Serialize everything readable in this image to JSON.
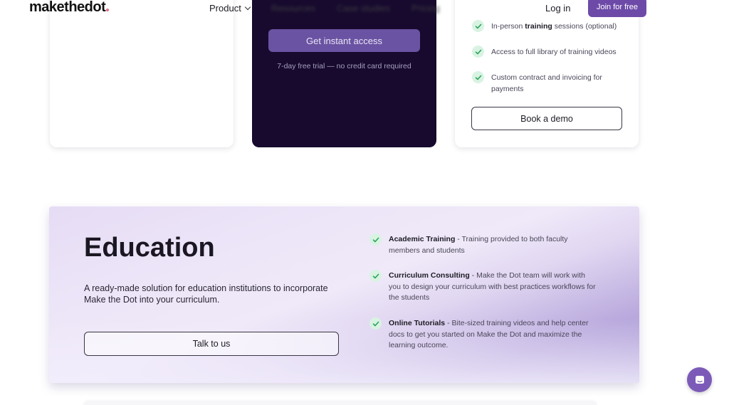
{
  "header": {
    "logo": "makethedot",
    "nav": [
      {
        "label": "Product",
        "has_dropdown": true
      },
      {
        "label": "Resources"
      },
      {
        "label": "Case studies"
      },
      {
        "label": "Pricing"
      }
    ],
    "login_label": "Log in",
    "join_label": "Join for free"
  },
  "pricing": {
    "middle": {
      "cta_label": "Get instant access",
      "trial_note": "7-day free trial — no credit card required"
    },
    "right": {
      "features": [
        {
          "before": "In-person ",
          "bold": "training",
          "after": " sessions (optional)"
        },
        {
          "before": "Access to full library of training videos",
          "bold": "",
          "after": ""
        },
        {
          "before": "Custom contract and invoicing for payments",
          "bold": "",
          "after": ""
        }
      ],
      "cta_label": "Book a demo"
    }
  },
  "education": {
    "title": "Education",
    "description": "A ready-made solution for education institutions to incorporate Make the Dot into your curriculum.",
    "cta_label": "Talk to us",
    "features": [
      {
        "title": "Academic Training",
        "text": " - Training provided to both faculty members and students"
      },
      {
        "title": "Curriculum Consulting",
        "text": " - Make the Dot team will work with you to design your curriculum with best practices workflows for the students"
      },
      {
        "title": "Online Tutorials",
        "text": " - Bite-sized training videos and help center docs to get you started on Make the Dot and maximize the learning outcome."
      }
    ]
  },
  "colors": {
    "brand": "#6d4aa8",
    "dark_card": "#170a2e",
    "check_bg": "#d8f3e2",
    "check": "#2aa35a"
  },
  "icons": {
    "check": "check-icon",
    "chat": "chat-icon",
    "dropdown": "chevron-down-icon"
  }
}
